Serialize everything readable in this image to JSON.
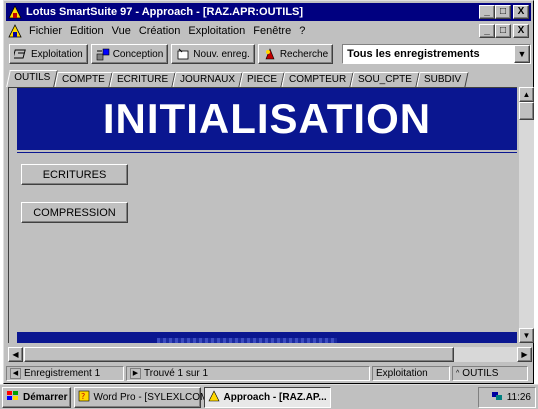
{
  "window": {
    "title": "Lotus SmartSuite 97   -  Approach - [RAZ.APR:OUTILS]",
    "minimize_label": "_",
    "maximize_label": "□",
    "close_label": "X"
  },
  "menu": {
    "items": [
      "Fichier",
      "Edition",
      "Vue",
      "Création",
      "Exploitation",
      "Fenêtre",
      "?"
    ]
  },
  "mdi_controls": {
    "minimize_label": "_",
    "restore_label": "□",
    "close_label": "X"
  },
  "toolbar": {
    "exploitation_label": "Exploitation",
    "conception_label": "Conception",
    "new_record_label": "Nouv. enreg.",
    "search_label": "Recherche",
    "recordset_value": "Tous les enregistrements"
  },
  "tabs": [
    "OUTILS",
    "COMPTE",
    "ECRITURE",
    "JOURNAUX",
    "PIECE",
    "COMPTEUR",
    "SOU_CPTE",
    "SUBDIV"
  ],
  "form": {
    "banner_title": "INITIALISATION",
    "ecritures_label": "ECRITURES",
    "compression_label": "COMPRESSION"
  },
  "status": {
    "record": "Enregistrement 1",
    "found": "Trouvé 1 sur 1",
    "mode": "Exploitation",
    "view": "OUTILS"
  },
  "taskbar": {
    "start_label": "Démarrer",
    "tasks": [
      "Word Pro - [SYLEXLCOM...",
      "Approach - [RAZ.AP..."
    ],
    "clock": "11:26"
  },
  "colors": {
    "title_bar": "#000080",
    "banner": "#0a1690",
    "face": "#c0c0c0"
  }
}
